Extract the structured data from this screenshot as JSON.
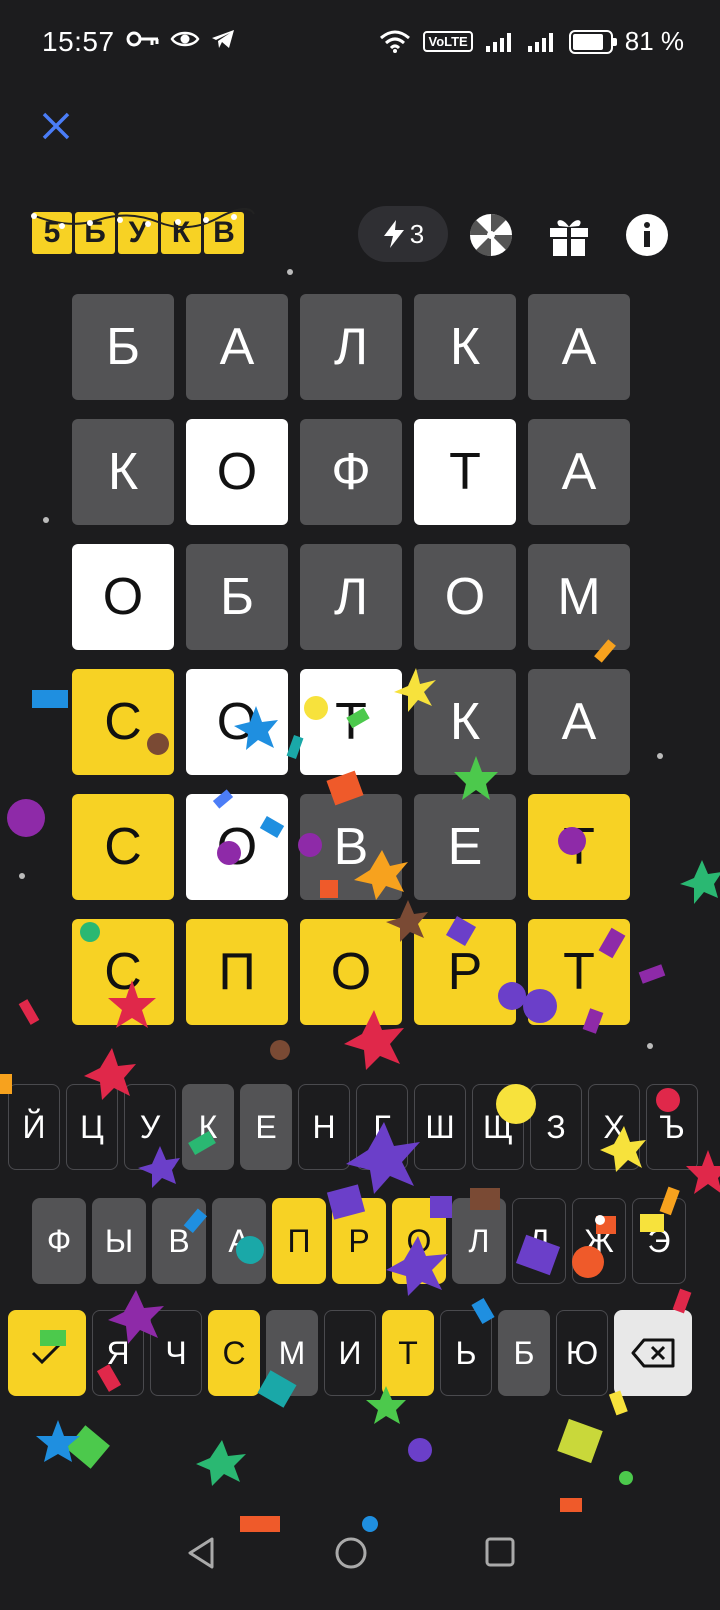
{
  "status_bar": {
    "time": "15:57",
    "volte": "VoLTE",
    "battery": "81 %"
  },
  "header": {
    "close_icon": "close-icon",
    "logo_letters": [
      "5",
      "Б",
      "У",
      "К",
      "В"
    ],
    "energy_count": "3",
    "icons": [
      "wheel-icon",
      "gift-icon",
      "info-icon"
    ]
  },
  "board": {
    "rows": [
      [
        {
          "l": "Б",
          "s": "gray"
        },
        {
          "l": "А",
          "s": "gray"
        },
        {
          "l": "Л",
          "s": "gray"
        },
        {
          "l": "К",
          "s": "gray"
        },
        {
          "l": "А",
          "s": "gray"
        }
      ],
      [
        {
          "l": "К",
          "s": "gray"
        },
        {
          "l": "О",
          "s": "white"
        },
        {
          "l": "Ф",
          "s": "gray"
        },
        {
          "l": "Т",
          "s": "white"
        },
        {
          "l": "А",
          "s": "gray"
        }
      ],
      [
        {
          "l": "О",
          "s": "white"
        },
        {
          "l": "Б",
          "s": "gray"
        },
        {
          "l": "Л",
          "s": "gray"
        },
        {
          "l": "О",
          "s": "gray"
        },
        {
          "l": "М",
          "s": "gray"
        }
      ],
      [
        {
          "l": "С",
          "s": "yellow"
        },
        {
          "l": "О",
          "s": "white"
        },
        {
          "l": "Т",
          "s": "white"
        },
        {
          "l": "К",
          "s": "gray"
        },
        {
          "l": "А",
          "s": "gray"
        }
      ],
      [
        {
          "l": "С",
          "s": "yellow"
        },
        {
          "l": "О",
          "s": "white"
        },
        {
          "l": "В",
          "s": "gray"
        },
        {
          "l": "Е",
          "s": "gray"
        },
        {
          "l": "Т",
          "s": "yellow"
        }
      ],
      [
        {
          "l": "С",
          "s": "yellow"
        },
        {
          "l": "П",
          "s": "yellow"
        },
        {
          "l": "О",
          "s": "yellow"
        },
        {
          "l": "Р",
          "s": "yellow"
        },
        {
          "l": "Т",
          "s": "yellow"
        }
      ]
    ]
  },
  "keyboard": {
    "row1": [
      {
        "k": "Й",
        "s": "def"
      },
      {
        "k": "Ц",
        "s": "def"
      },
      {
        "k": "У",
        "s": "def"
      },
      {
        "k": "К",
        "s": "gray"
      },
      {
        "k": "Е",
        "s": "gray"
      },
      {
        "k": "Н",
        "s": "def"
      },
      {
        "k": "Г",
        "s": "def"
      },
      {
        "k": "Ш",
        "s": "def"
      },
      {
        "k": "Щ",
        "s": "def"
      },
      {
        "k": "З",
        "s": "def"
      },
      {
        "k": "Х",
        "s": "def"
      },
      {
        "k": "Ъ",
        "s": "def"
      }
    ],
    "row2": [
      {
        "k": "Ф",
        "s": "gray"
      },
      {
        "k": "Ы",
        "s": "gray"
      },
      {
        "k": "В",
        "s": "gray"
      },
      {
        "k": "А",
        "s": "gray"
      },
      {
        "k": "П",
        "s": "yellow"
      },
      {
        "k": "Р",
        "s": "yellow"
      },
      {
        "k": "О",
        "s": "yellow"
      },
      {
        "k": "Л",
        "s": "gray"
      },
      {
        "k": "Д",
        "s": "def"
      },
      {
        "k": "Ж",
        "s": "def"
      },
      {
        "k": "Э",
        "s": "def"
      }
    ],
    "row3": [
      {
        "k": "Я",
        "s": "def"
      },
      {
        "k": "Ч",
        "s": "def"
      },
      {
        "k": "С",
        "s": "yellow"
      },
      {
        "k": "М",
        "s": "gray"
      },
      {
        "k": "И",
        "s": "def"
      },
      {
        "k": "Т",
        "s": "yellow"
      },
      {
        "k": "Ь",
        "s": "def"
      },
      {
        "k": "Б",
        "s": "gray"
      },
      {
        "k": "Ю",
        "s": "def"
      }
    ],
    "enter_icon": "check-icon",
    "backspace_icon": "backspace-icon"
  },
  "nav_bar": {
    "icons": [
      "back-icon",
      "home-icon",
      "recents-icon"
    ]
  },
  "colors": {
    "bg": "#1c1c1e",
    "gray": "#535355",
    "yellow": "#f7d224",
    "white": "#ffffff",
    "accent": "#4a7df7"
  }
}
